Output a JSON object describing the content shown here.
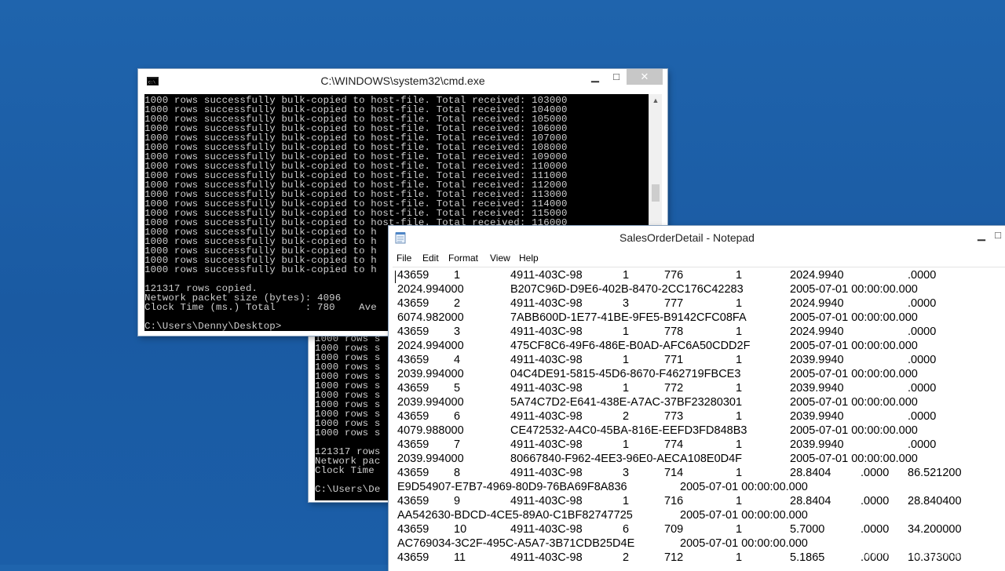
{
  "cmd_main": {
    "title": "C:\\WINDOWS\\system32\\cmd.exe",
    "lines": [
      "1000 rows successfully bulk-copied to host-file. Total received: 103000",
      "1000 rows successfully bulk-copied to host-file. Total received: 104000",
      "1000 rows successfully bulk-copied to host-file. Total received: 105000",
      "1000 rows successfully bulk-copied to host-file. Total received: 106000",
      "1000 rows successfully bulk-copied to host-file. Total received: 107000",
      "1000 rows successfully bulk-copied to host-file. Total received: 108000",
      "1000 rows successfully bulk-copied to host-file. Total received: 109000",
      "1000 rows successfully bulk-copied to host-file. Total received: 110000",
      "1000 rows successfully bulk-copied to host-file. Total received: 111000",
      "1000 rows successfully bulk-copied to host-file. Total received: 112000",
      "1000 rows successfully bulk-copied to host-file. Total received: 113000",
      "1000 rows successfully bulk-copied to host-file. Total received: 114000",
      "1000 rows successfully bulk-copied to host-file. Total received: 115000",
      "1000 rows successfully bulk-copied to host-file. Total received: 116000",
      "1000 rows successfully bulk-copied to h",
      "1000 rows successfully bulk-copied to h",
      "1000 rows successfully bulk-copied to h",
      "1000 rows successfully bulk-copied to h",
      "1000 rows successfully bulk-copied to h",
      "",
      "121317 rows copied.",
      "Network packet size (bytes): 4096",
      "Clock Time (ms.) Total     : 780    Ave",
      "",
      "C:\\Users\\Denny\\Desktop>"
    ]
  },
  "cmd_back": {
    "lines": [
      "1000 rows s",
      "1000 rows s",
      "1000 rows s",
      "1000 rows s",
      "1000 rows s",
      "1000 rows s",
      "1000 rows s",
      "1000 rows s",
      "1000 rows s",
      "1000 rows s",
      "1000 rows s",
      "",
      "121317 rows",
      "Network pac",
      "Clock Time ",
      "",
      "C:\\Users\\De"
    ]
  },
  "notepad": {
    "title": "SalesOrderDetail - Notepad",
    "menu": [
      "File",
      "Edit",
      "Format",
      "View",
      "Help"
    ],
    "rows": [
      [
        "43659",
        "1",
        "4911-403C-98",
        "1",
        "776",
        "1",
        "2024.9940",
        ".0000"
      ],
      [
        "2024.994000",
        "",
        "B207C96D-D9E6-402B-8470-2CC176C42283",
        "",
        "",
        "",
        "2005-07-01 00:00:00.000",
        ""
      ],
      [
        "43659",
        "2",
        "4911-403C-98",
        "3",
        "777",
        "1",
        "2024.9940",
        ".0000"
      ],
      [
        "6074.982000",
        "",
        "7ABB600D-1E77-41BE-9FE5-B9142CFC08FA",
        "",
        "",
        "",
        "2005-07-01 00:00:00.000",
        ""
      ],
      [
        "43659",
        "3",
        "4911-403C-98",
        "1",
        "778",
        "1",
        "2024.9940",
        ".0000"
      ],
      [
        "2024.994000",
        "",
        "475CF8C6-49F6-486E-B0AD-AFC6A50CDD2F",
        "",
        "",
        "",
        "2005-07-01 00:00:00.000",
        ""
      ],
      [
        "43659",
        "4",
        "4911-403C-98",
        "1",
        "771",
        "1",
        "2039.9940",
        ".0000"
      ],
      [
        "2039.994000",
        "",
        "04C4DE91-5815-45D6-8670-F462719FBCE3",
        "",
        "",
        "",
        "2005-07-01 00:00:00.000",
        ""
      ],
      [
        "43659",
        "5",
        "4911-403C-98",
        "1",
        "772",
        "1",
        "2039.9940",
        ".0000"
      ],
      [
        "2039.994000",
        "",
        "5A74C7D2-E641-438E-A7AC-37BF23280301",
        "",
        "",
        "",
        "2005-07-01 00:00:00.000",
        ""
      ],
      [
        "43659",
        "6",
        "4911-403C-98",
        "2",
        "773",
        "1",
        "2039.9940",
        ".0000"
      ],
      [
        "4079.988000",
        "",
        "CE472532-A4C0-45BA-816E-EEFD3FD848B3",
        "",
        "",
        "",
        "2005-07-01 00:00:00.000",
        ""
      ],
      [
        "43659",
        "7",
        "4911-403C-98",
        "1",
        "774",
        "1",
        "2039.9940",
        ".0000"
      ],
      [
        "2039.994000",
        "",
        "80667840-F962-4EE3-96E0-AECA108E0D4F",
        "",
        "",
        "",
        "2005-07-01 00:00:00.000",
        ""
      ]
    ],
    "rows_b": [
      [
        "43659",
        "8",
        "4911-403C-98",
        "3",
        "714",
        "1",
        "28.8404",
        ".0000",
        "86.521200"
      ],
      [
        "E9D54907-E7B7-4969-80D9-76BA69F8A836",
        "2005-07-01 00:00:00.000"
      ],
      [
        "43659",
        "9",
        "4911-403C-98",
        "1",
        "716",
        "1",
        "28.8404",
        ".0000",
        "28.840400"
      ],
      [
        "AA542630-BDCD-4CE5-89A0-C1BF82747725",
        "2005-07-01 00:00:00.000"
      ],
      [
        "43659",
        "10",
        "4911-403C-98",
        "6",
        "709",
        "1",
        "5.7000",
        ".0000",
        "34.200000"
      ],
      [
        "AC769034-3C2F-495C-A5A7-3B71CDB25D4E",
        "2005-07-01 00:00:00.000"
      ],
      [
        "43659",
        "11",
        "4911-403C-98",
        "2",
        "712",
        "1",
        "5.1865",
        ".0000",
        "10.373000"
      ]
    ]
  },
  "watermark": "InfiniteSkills.com"
}
